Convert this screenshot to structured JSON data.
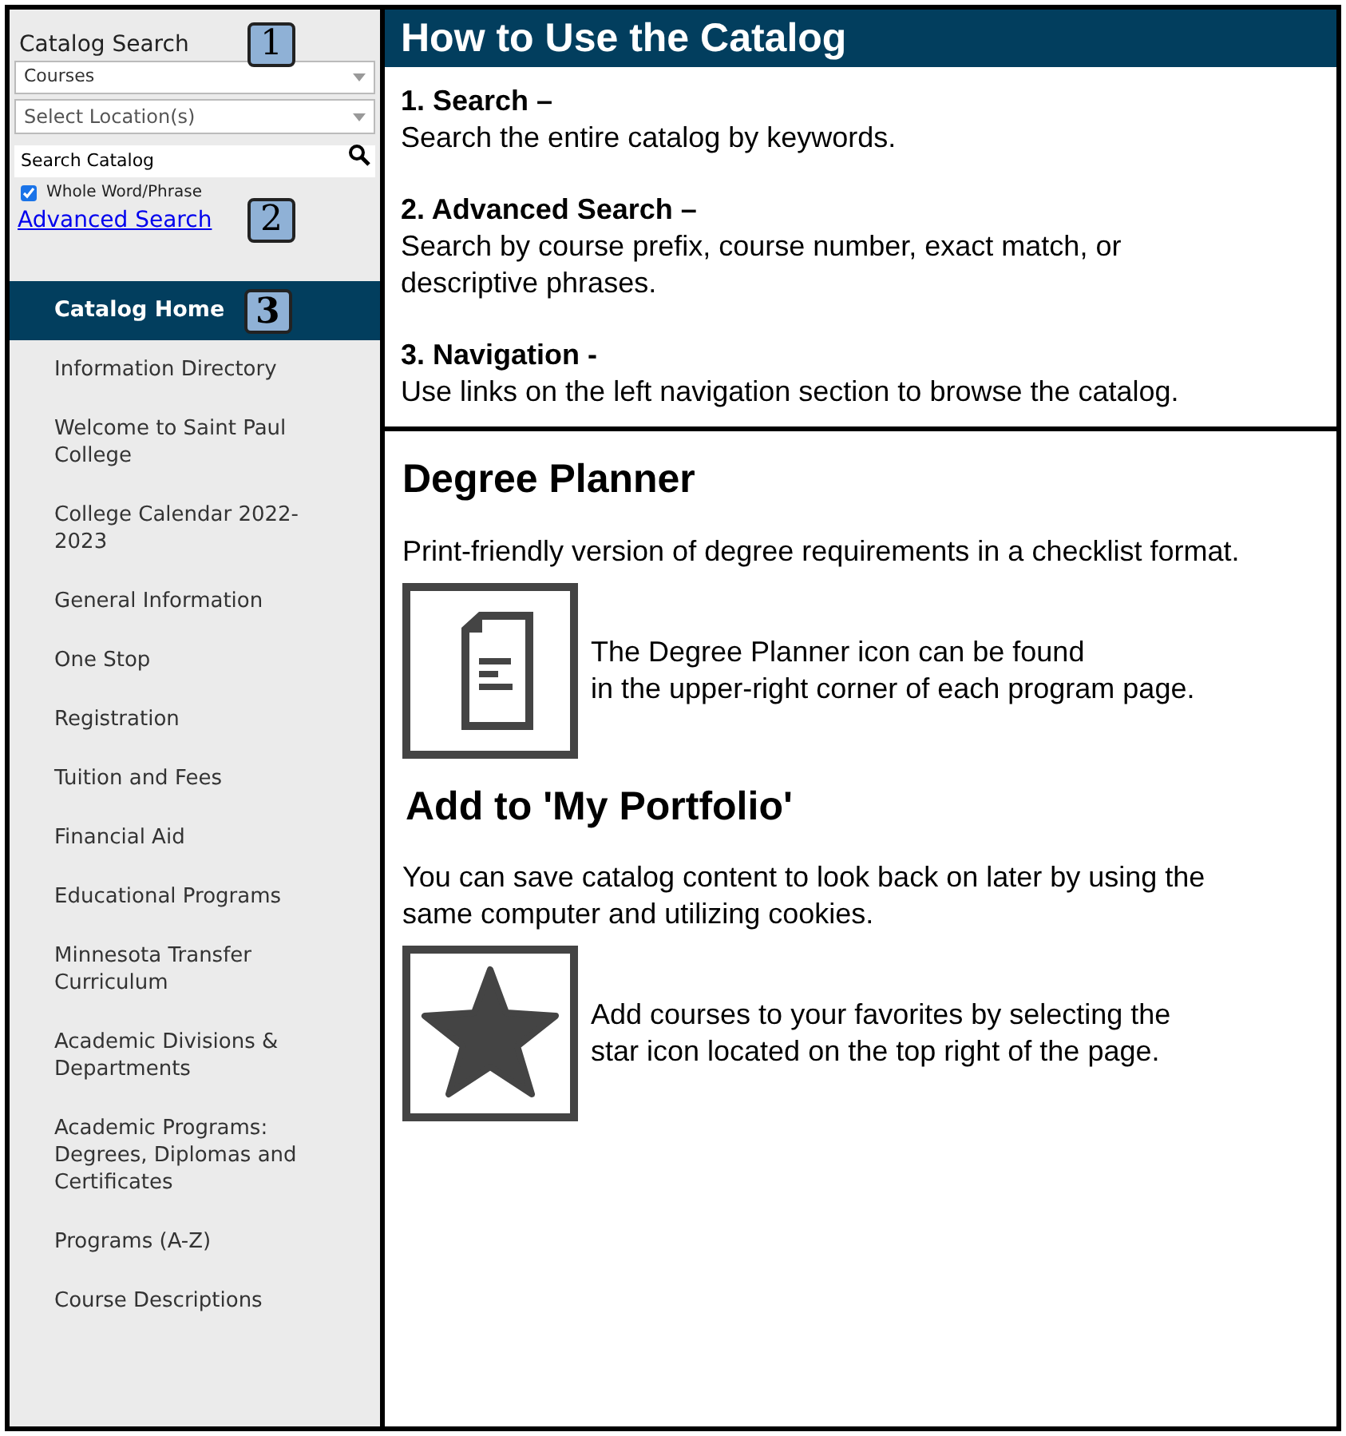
{
  "search": {
    "title": "Catalog Search",
    "title_marker": "1",
    "category": {
      "value": "Courses"
    },
    "location": {
      "placeholder": "Select Location(s)"
    },
    "query": {
      "placeholder": "Search Catalog"
    },
    "whole_word": {
      "label": "Whole Word/Phrase",
      "checked": true
    },
    "advanced_link": "Advanced Search",
    "advanced_marker": "2"
  },
  "nav": [
    {
      "label": "Catalog Home",
      "selected": true,
      "marker": "3"
    },
    {
      "label": "Information Directory",
      "selected": false
    },
    {
      "label": "Welcome to Saint Paul College",
      "selected": false
    },
    {
      "label": "College Calendar 2022-2023",
      "selected": false
    },
    {
      "label": "General Information",
      "selected": false
    },
    {
      "label": "One Stop",
      "selected": false
    },
    {
      "label": "Registration",
      "selected": false
    },
    {
      "label": "Tuition and Fees",
      "selected": false
    },
    {
      "label": "Financial Aid",
      "selected": false
    },
    {
      "label": "Educational Programs",
      "selected": false
    },
    {
      "label": "Minnesota Transfer Curriculum",
      "selected": false
    },
    {
      "label": "Academic Divisions & Departments",
      "selected": false
    },
    {
      "label": "Academic Programs: Degrees, Diplomas and Certificates",
      "selected": false
    },
    {
      "label": "Programs (A-Z)",
      "selected": false
    },
    {
      "label": "Course Descriptions",
      "selected": false
    }
  ],
  "how_to": {
    "title": "How to Use the Catalog",
    "steps": [
      {
        "heading": "1. Search –",
        "text": "Search the entire catalog by keywords."
      },
      {
        "heading": "2. Advanced Search –",
        "text": "Search by course prefix, course number, exact match, or descriptive phrases."
      },
      {
        "heading": "3. Navigation -",
        "text": "Use links on the left navigation section to browse the catalog."
      }
    ]
  },
  "features": [
    {
      "title": "Degree Planner",
      "text": "Print-friendly version of degree requirements in a checklist format.",
      "kind": "document",
      "note": [
        "The Degree Planner icon can be found",
        "in the upper-right corner of each program page."
      ]
    },
    {
      "title": "Add to 'My Portfolio'",
      "text": "You can save catalog content to look back on later by using the same computer and utilizing cookies.",
      "kind": "star",
      "note": [
        "Add courses to your favorites by selecting the",
        "star icon located on the top right of the page."
      ]
    }
  ]
}
